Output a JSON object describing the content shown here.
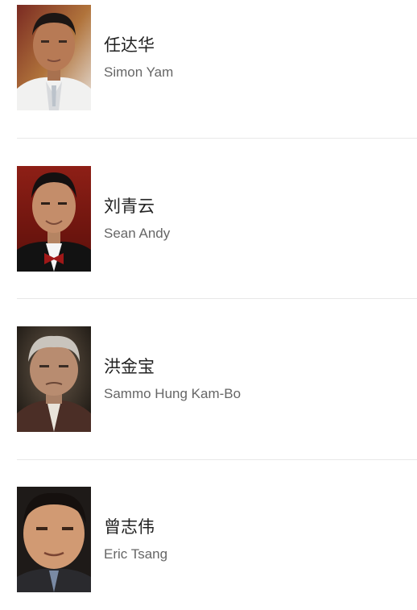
{
  "cast": [
    {
      "name": "任达华",
      "english_name": "Simon Yam",
      "photo_icon": "actor-portrait-simon-yam"
    },
    {
      "name": "刘青云",
      "english_name": "Sean Andy",
      "photo_icon": "actor-portrait-sean-andy"
    },
    {
      "name": "洪金宝",
      "english_name": "Sammo Hung Kam-Bo",
      "photo_icon": "actor-portrait-sammo-hung"
    },
    {
      "name": "曾志伟",
      "english_name": "Eric Tsang",
      "photo_icon": "actor-portrait-eric-tsang"
    }
  ]
}
